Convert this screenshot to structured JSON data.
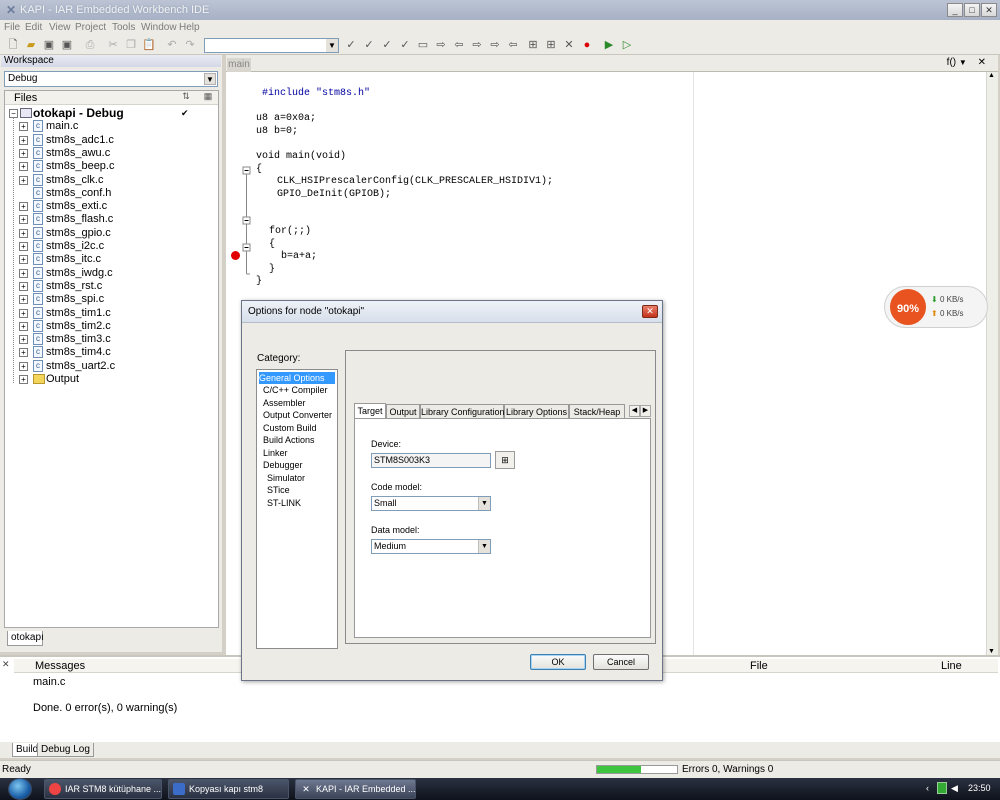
{
  "window": {
    "title": "KAPI - IAR Embedded Workbench IDE",
    "app_icon": "iar-icon",
    "controls": [
      "minimize",
      "maximize",
      "close"
    ]
  },
  "menu": [
    "File",
    "Edit",
    "View",
    "Project",
    "Tools",
    "Window",
    "Help"
  ],
  "toolbar": {
    "combo_value": ""
  },
  "workspace": {
    "header": "Workspace",
    "config": "Debug",
    "files_label": "Files",
    "project": "otokapi - Debug",
    "files": [
      "main.c",
      "stm8s_adc1.c",
      "stm8s_awu.c",
      "stm8s_beep.c",
      "stm8s_clk.c",
      "stm8s_conf.h",
      "stm8s_exti.c",
      "stm8s_flash.c",
      "stm8s_gpio.c",
      "stm8s_i2c.c",
      "stm8s_itc.c",
      "stm8s_iwdg.c",
      "stm8s_rst.c",
      "stm8s_spi.c",
      "stm8s_tim1.c",
      "stm8s_tim2.c",
      "stm8s_tim3.c",
      "stm8s_tim4.c",
      "stm8s_uart2.c"
    ],
    "output_folder": "Output",
    "tab": "otokapı"
  },
  "editor": {
    "tab": "main",
    "func_button": "f()",
    "lines": [
      "#include \"stm8s.h\"",
      "u8 a=0x0a;",
      "u8 b=0;",
      "void main(void)",
      "{",
      "    CLK_HSIPrescalerConfig(CLK_PRESCALER_HSIDIV1);",
      "    GPIO_DeInit(GPIOB);",
      "  for(;;)",
      "  {",
      "    b=a+a;",
      "  }",
      "}"
    ]
  },
  "network_widget": {
    "percent": "90%",
    "down": "0 KB/s",
    "up": "0 KB/s"
  },
  "dialog": {
    "title": "Options for node \"otokapi\"",
    "category_label": "Category:",
    "categories": [
      "General Options",
      "C/C++ Compiler",
      "Assembler",
      "Output Converter",
      "Custom Build",
      "Build Actions",
      "Linker",
      "Debugger",
      "Simulator",
      "STice",
      "ST-LINK"
    ],
    "selected_category": "General Options",
    "tabs": [
      "Target",
      "Output",
      "Library Configuration",
      "Library Options",
      "Stack/Heap"
    ],
    "active_tab": "Target",
    "device_label": "Device:",
    "device_value": "STM8S003K3",
    "code_model_label": "Code model:",
    "code_model_value": "Small",
    "data_model_label": "Data model:",
    "data_model_value": "Medium",
    "ok": "OK",
    "cancel": "Cancel"
  },
  "messages": {
    "col_messages": "Messages",
    "col_file": "File",
    "col_line": "Line",
    "rows": [
      "main.c",
      "Done. 0 error(s), 0 warning(s)"
    ],
    "tabs": [
      "Build",
      "Debug Log"
    ]
  },
  "status": {
    "left": "Ready",
    "progress": 0.55,
    "right": "Errors 0, Warnings 0"
  },
  "taskbar": {
    "items": [
      "IAR STM8 kütüphane ...",
      "Kopyası kapı stm8",
      "KAPI - IAR Embedded ..."
    ],
    "active_index": 2,
    "clock": "23:50"
  }
}
